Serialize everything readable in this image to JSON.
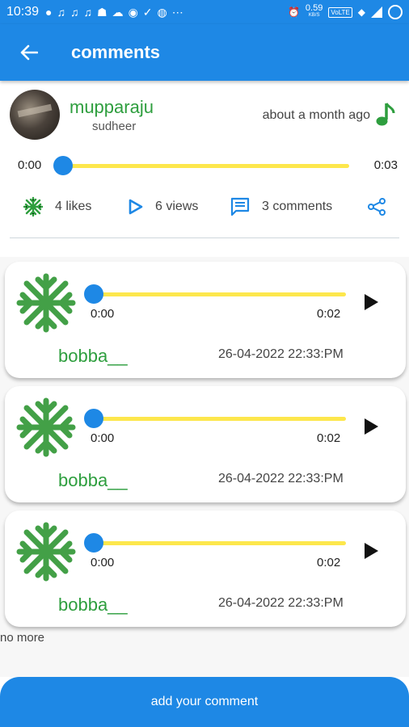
{
  "status_bar": {
    "time": "10:39",
    "speed_value": "0.59",
    "speed_unit": "KB/S",
    "volte": "VoLTE",
    "icons": [
      "message-icon",
      "music-note-icon",
      "music-note-icon",
      "music-note-icon",
      "snapchat-icon",
      "cloud-icon",
      "drop-icon",
      "check-circle-icon",
      "globe-icon",
      "mobile-data-icon",
      "alarm-icon",
      "wifi-icon",
      "signal-icon",
      "battery-icon"
    ]
  },
  "app_bar": {
    "title": "comments"
  },
  "post": {
    "username": "mupparaju",
    "subname": "sudheer",
    "time_ago": "about a month ago",
    "player": {
      "start": "0:00",
      "end": "0:03",
      "progress": 0
    },
    "likes_count": "4",
    "likes_label": "likes",
    "views_count": "6",
    "views_label": "views",
    "comments_count": "3",
    "comments_label": "comments"
  },
  "comments": [
    {
      "username": "bobba__",
      "date": "26-04-2022 22:33:PM",
      "start": "0:00",
      "end": "0:02",
      "progress": 0
    },
    {
      "username": "bobba__",
      "date": "26-04-2022 22:33:PM",
      "start": "0:00",
      "end": "0:02",
      "progress": 0
    },
    {
      "username": "bobba__",
      "date": "26-04-2022 22:33:PM",
      "start": "0:00",
      "end": "0:02",
      "progress": 0
    }
  ],
  "no_more_label": "no more",
  "add_comment_label": "add your comment",
  "colors": {
    "primary": "#1e88e5",
    "accent_green": "#2e9e3e",
    "track_yellow": "#fde74c"
  }
}
